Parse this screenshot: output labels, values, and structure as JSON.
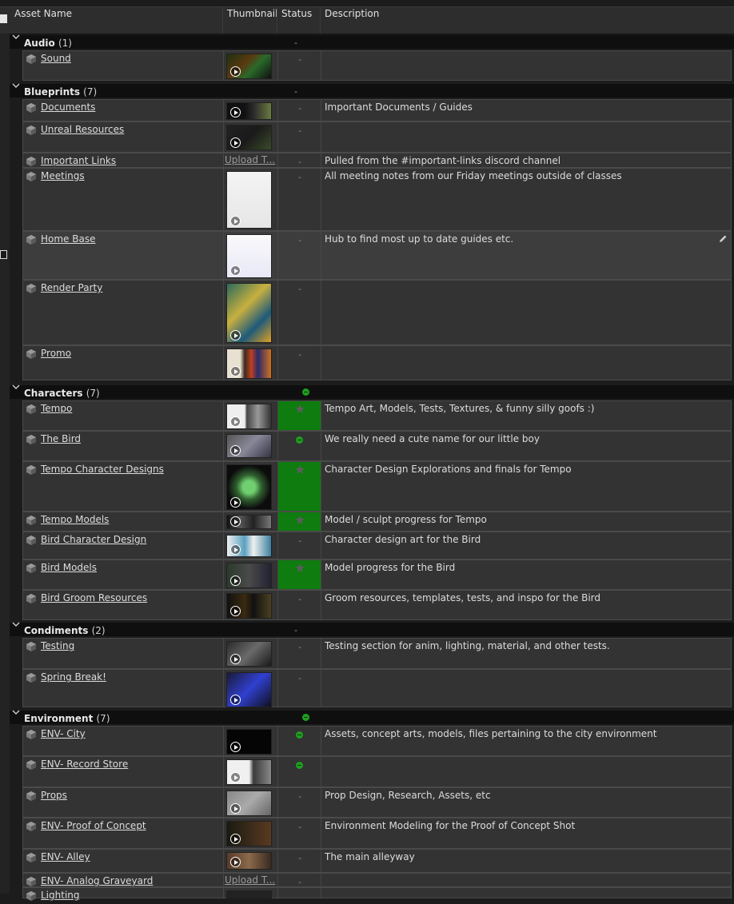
{
  "header": {
    "asset_name": "Asset Name",
    "thumbnail": "Thumbnail",
    "status": "Status",
    "description": "Description"
  },
  "icons": {
    "select_all": "checkbox-icon",
    "row_select": "checkbox-icon",
    "collapse": "chevron-down-icon",
    "asset": "asset-icon",
    "play": "play-icon",
    "star": "star-icon",
    "edit": "pencil-icon"
  },
  "colors": {
    "status_green": "#0e7c0e",
    "status_dot": "#1ea01e"
  },
  "groups": [
    {
      "title": "Audio",
      "count": "(1)",
      "status": "-",
      "rows": [
        {
          "name": "Sound",
          "desc": "",
          "status": "-"
        }
      ]
    },
    {
      "title": "Blueprints",
      "count": "(7)",
      "status": "-",
      "rows": [
        {
          "name": "Documents",
          "desc": "Important Documents / Guides",
          "status": "-"
        },
        {
          "name": "Unreal Resources",
          "desc": "",
          "status": "-"
        },
        {
          "name": "Important Links",
          "desc": "Pulled from the #important-links discord channel",
          "status": "-",
          "thumb": "Upload T..."
        },
        {
          "name": "Meetings",
          "desc": "All meeting notes from our Friday meetings outside of classes",
          "status": "-"
        },
        {
          "name": "Home Base",
          "desc": "Hub to find most up to date guides etc.",
          "status": "-"
        },
        {
          "name": "Render Party",
          "desc": "",
          "status": "-"
        },
        {
          "name": "Promo",
          "desc": "",
          "status": "-"
        }
      ]
    },
    {
      "title": "Characters",
      "count": "(7)",
      "status": "green",
      "rows": [
        {
          "name": "Tempo",
          "desc": "Tempo Art, Models, Tests, Textures, & funny silly goofs :)",
          "status": "star"
        },
        {
          "name": "The Bird",
          "desc": "We really need a cute name for our little boy",
          "status": "green"
        },
        {
          "name": "Tempo Character Designs",
          "desc": "Character Design Explorations and finals for Tempo",
          "status": "star"
        },
        {
          "name": "Tempo Models",
          "desc": "Model / sculpt progress for Tempo",
          "status": "star"
        },
        {
          "name": "Bird Character Design",
          "desc": "Character design art for the Bird",
          "status": "-"
        },
        {
          "name": "Bird Models",
          "desc": "Model progress for the Bird",
          "status": "star"
        },
        {
          "name": "Bird Groom Resources",
          "desc": "Groom resources, templates, tests, and inspo for the Bird",
          "status": "-"
        }
      ]
    },
    {
      "title": "Condiments",
      "count": "(2)",
      "status": "-",
      "rows": [
        {
          "name": "Testing",
          "desc": "Testing section for anim, lighting, material, and other tests.",
          "status": "-"
        },
        {
          "name": "Spring Break!",
          "desc": "",
          "status": "-"
        }
      ]
    },
    {
      "title": "Environment",
      "count": "(7)",
      "status": "green",
      "rows": [
        {
          "name": "ENV- City",
          "desc": "Assets, concept arts, models, files pertaining to the city environment",
          "status": "green"
        },
        {
          "name": "ENV- Record Store",
          "desc": "",
          "status": "green"
        },
        {
          "name": "Props",
          "desc": "Prop Design, Research, Assets, etc",
          "status": "-"
        },
        {
          "name": "ENV- Proof of Concept",
          "desc": "Environment Modeling for the Proof of Concept Shot",
          "status": "-"
        },
        {
          "name": "ENV- Alley",
          "desc": "The main alleyway",
          "status": "-"
        },
        {
          "name": "ENV- Analog Graveyard",
          "desc": "",
          "status": "-",
          "thumb": "Upload T..."
        },
        {
          "name": "Lighting",
          "desc": "",
          "status": ""
        }
      ]
    }
  ]
}
